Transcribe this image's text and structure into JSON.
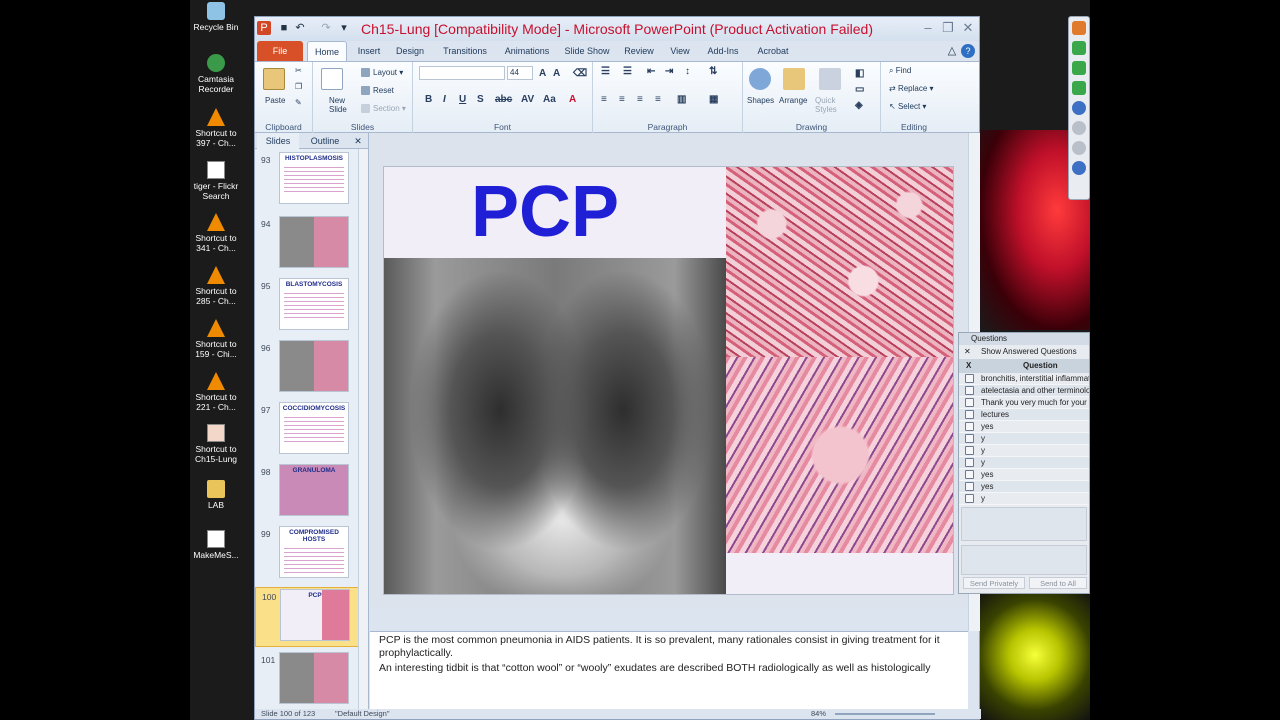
{
  "desktop": {
    "icons": [
      {
        "label": "Recycle Bin",
        "icon": "recycle-bin-icon"
      },
      {
        "label": "Camtasia Recorder",
        "icon": "camtasia-icon"
      },
      {
        "label": "Shortcut to 397 - Ch...",
        "icon": "vlc-icon"
      },
      {
        "label": "tiger - Flickr Search",
        "icon": "document-icon"
      },
      {
        "label": "Shortcut to 341 - Ch...",
        "icon": "vlc-icon"
      },
      {
        "label": "Shortcut to 285 - Ch...",
        "icon": "vlc-icon"
      },
      {
        "label": "Shortcut to 159 - Chi...",
        "icon": "vlc-icon"
      },
      {
        "label": "Shortcut to 221 - Ch...",
        "icon": "vlc-icon"
      },
      {
        "label": "Shortcut to Ch15-Lung",
        "icon": "powerpoint-file-icon"
      },
      {
        "label": "LAB",
        "icon": "folder-icon"
      },
      {
        "label": "MakeMeS...",
        "icon": "document-icon"
      }
    ]
  },
  "window": {
    "title": "Ch15-Lung [Compatibility Mode]  -  Microsoft PowerPoint (Product Activation Failed)"
  },
  "tabs": [
    "File",
    "Home",
    "Insert",
    "Design",
    "Transitions",
    "Animations",
    "Slide Show",
    "Review",
    "View",
    "Add-Ins",
    "Acrobat"
  ],
  "ribbon": {
    "clipboard": {
      "label": "Clipboard",
      "paste": "Paste"
    },
    "slides": {
      "label": "Slides",
      "new_slide": "New Slide",
      "layout": "Layout",
      "reset": "Reset",
      "section": "Section"
    },
    "font": {
      "label": "Font",
      "size": "44"
    },
    "paragraph": {
      "label": "Paragraph"
    },
    "drawing": {
      "label": "Drawing",
      "shapes": "Shapes",
      "arrange": "Arrange",
      "quick_styles": "Quick Styles"
    },
    "editing": {
      "label": "Editing",
      "find": "Find",
      "replace": "Replace",
      "select": "Select"
    }
  },
  "side_pane": {
    "tabs": [
      "Slides",
      "Outline"
    ],
    "slides": [
      {
        "num": "93",
        "title": "HISTOPLASMOSIS"
      },
      {
        "num": "94",
        "title": ""
      },
      {
        "num": "95",
        "title": "BLASTOMYCOSIS"
      },
      {
        "num": "96",
        "title": ""
      },
      {
        "num": "97",
        "title": "COCCIDIOMYCOSIS"
      },
      {
        "num": "98",
        "title": "GRANULOMA"
      },
      {
        "num": "99",
        "title": "COMPROMISED  HOSTS"
      },
      {
        "num": "100",
        "title": "PCP"
      },
      {
        "num": "101",
        "title": ""
      }
    ],
    "selected_index": 7
  },
  "slide": {
    "title": "PCP"
  },
  "notes": {
    "line1": "PCP is the most common pneumonia in AIDS patients. It is so prevalent, many rationales consist in giving treatment for it prophylactically.",
    "line2": "An interesting tidbit is that “cotton wool” or “wooly” exudates are described BOTH radiologically as well as histologically"
  },
  "status": {
    "slide_of": "Slide 100 of 123",
    "theme": "\"Default Design\"",
    "zoom": "84%"
  },
  "questions_panel": {
    "title": "Questions",
    "show_answered": "Show Answered Questions",
    "col_x": "X",
    "col_question": "Question",
    "rows": [
      "bronchitis, interstitial inflammation",
      "atelectasia and other terminology",
      "Thank you very much for your",
      "lectures",
      "yes",
      "y",
      "y",
      "y",
      "yes",
      "yes",
      "y"
    ],
    "send_privately": "Send Privately",
    "send_to_all": "Send to All"
  }
}
